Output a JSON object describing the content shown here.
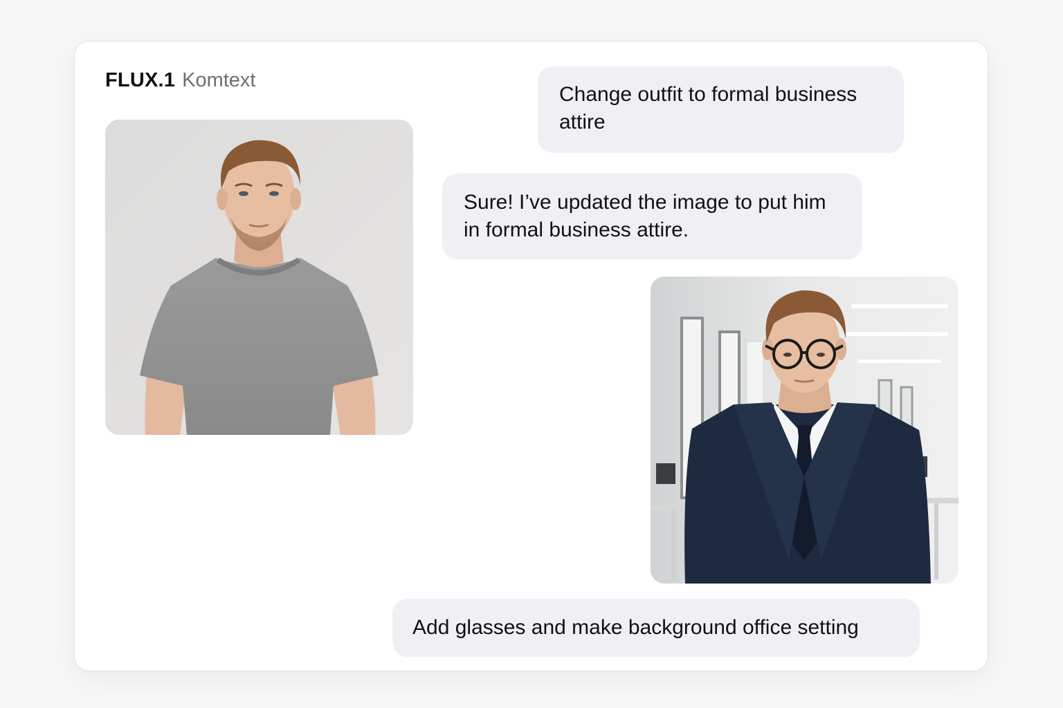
{
  "app": {
    "brand_main": "FLUX.1",
    "brand_sub": "Komtext"
  },
  "messages": [
    {
      "role": "user",
      "text": "Change outfit to formal business attire"
    },
    {
      "role": "assistant",
      "text": "Sure! I’ve updated the image to put him in formal business attire."
    },
    {
      "role": "user",
      "text": "Add glasses and make background office setting"
    }
  ],
  "images": [
    {
      "icon": "portrait-casual-image"
    },
    {
      "icon": "portrait-business-office-image"
    }
  ],
  "colors": {
    "bubble": "#f0f0f4",
    "card": "#ffffff",
    "page": "#f7f7f8"
  }
}
